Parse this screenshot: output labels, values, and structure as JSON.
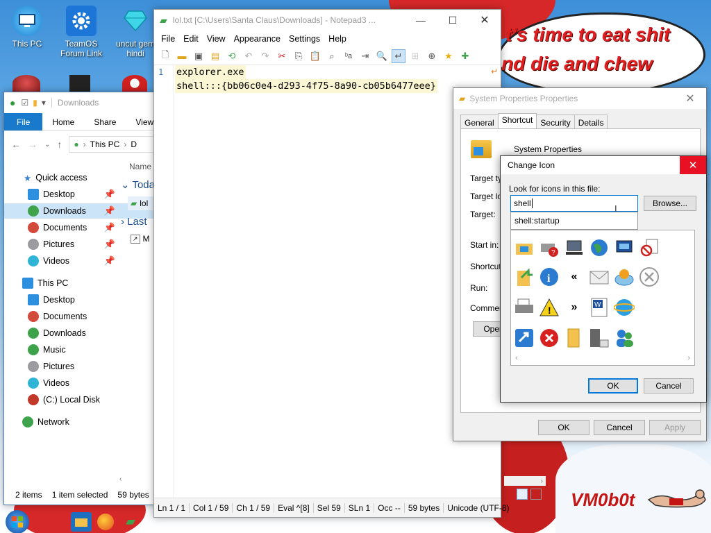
{
  "desktop": {
    "icons": [
      {
        "label": "This PC",
        "icon": "monitor-icon"
      },
      {
        "label": "TeamOS Forum Link",
        "icon": "gear-icon"
      },
      {
        "label": "uncut gem hindi",
        "icon": "diamond-icon"
      }
    ],
    "meme_line1": "t's time to eat shit",
    "meme_line2": "nd die and chew",
    "watermark": "VM0b0t"
  },
  "explorer": {
    "title": "Downloads",
    "tabs": [
      "File",
      "Home",
      "Share",
      "View"
    ],
    "breadcrumb": [
      "This PC",
      "D"
    ],
    "column_name": "Name",
    "groups": [
      "Toda",
      "Last"
    ],
    "files": [
      "lol",
      "M"
    ],
    "nav": [
      {
        "label": "Quick access",
        "color": "#3b7fd4"
      },
      {
        "label": "Desktop",
        "color": "#2d8fe0",
        "pinned": true
      },
      {
        "label": "Downloads",
        "color": "#3ea34a",
        "pinned": true,
        "selected": true
      },
      {
        "label": "Documents",
        "color": "#d24a3a",
        "pinned": true
      },
      {
        "label": "Pictures",
        "color": "#9c9ca0",
        "pinned": true
      },
      {
        "label": "Videos",
        "color": "#2fb3d6",
        "pinned": true
      },
      {
        "label": "This PC",
        "color": "#2d8fe0"
      },
      {
        "label": "Desktop",
        "color": "#2d8fe0"
      },
      {
        "label": "Documents",
        "color": "#d24a3a"
      },
      {
        "label": "Downloads",
        "color": "#3ea34a"
      },
      {
        "label": "Music",
        "color": "#3ea34a"
      },
      {
        "label": "Pictures",
        "color": "#9c9ca0"
      },
      {
        "label": "Videos",
        "color": "#2fb3d6"
      },
      {
        "label": "(C:) Local Disk",
        "color": "#c0392b"
      },
      {
        "label": "Network",
        "color": "#3ea34a"
      }
    ],
    "status_items": "2 items",
    "status_selected": "1 item selected",
    "status_size": "59 bytes"
  },
  "notepad": {
    "title": "lol.txt [C:\\Users\\Santa Claus\\Downloads] - Notepad3 ...",
    "menu": [
      "File",
      "Edit",
      "View",
      "Appearance",
      "Settings",
      "Help"
    ],
    "line_number": "1",
    "lines": [
      "explorer.exe",
      "shell:::{bb06c0e4-d293-4f75-8a90-cb05b6477eee}"
    ],
    "status": {
      "ln": "Ln 1 / 1",
      "col": "Col 1 / 59",
      "ch": "Ch 1 / 59",
      "eval": "Eval ^[8]",
      "sel": "Sel 59",
      "sln": "SLn 1",
      "occ": "Occ --",
      "bytes": "59 bytes",
      "encoding": "Unicode (UTF-8)"
    }
  },
  "sysprops": {
    "title": "System Properties Properties",
    "tabs": [
      "General",
      "Shortcut",
      "Security",
      "Details"
    ],
    "active_tab": "Shortcut",
    "name": "System Properties",
    "fields": [
      "Target typ",
      "Target loc",
      "Target:",
      "Start in:",
      "Shortcut",
      "Run:",
      "Comment"
    ],
    "open_button": "Open",
    "ok": "OK",
    "cancel": "Cancel",
    "apply": "Apply"
  },
  "changeicon": {
    "title": "Change Icon",
    "look_label": "Look for icons in this file:",
    "input_value": "shell",
    "suggestion": "shell:startup",
    "browse": "Browse...",
    "ok": "OK",
    "cancel": "Cancel"
  },
  "taskbar": {
    "start_icon": "windows-start-icon",
    "apps": [
      "file-explorer-icon",
      "firefox-icon",
      "notepad3-icon"
    ]
  }
}
